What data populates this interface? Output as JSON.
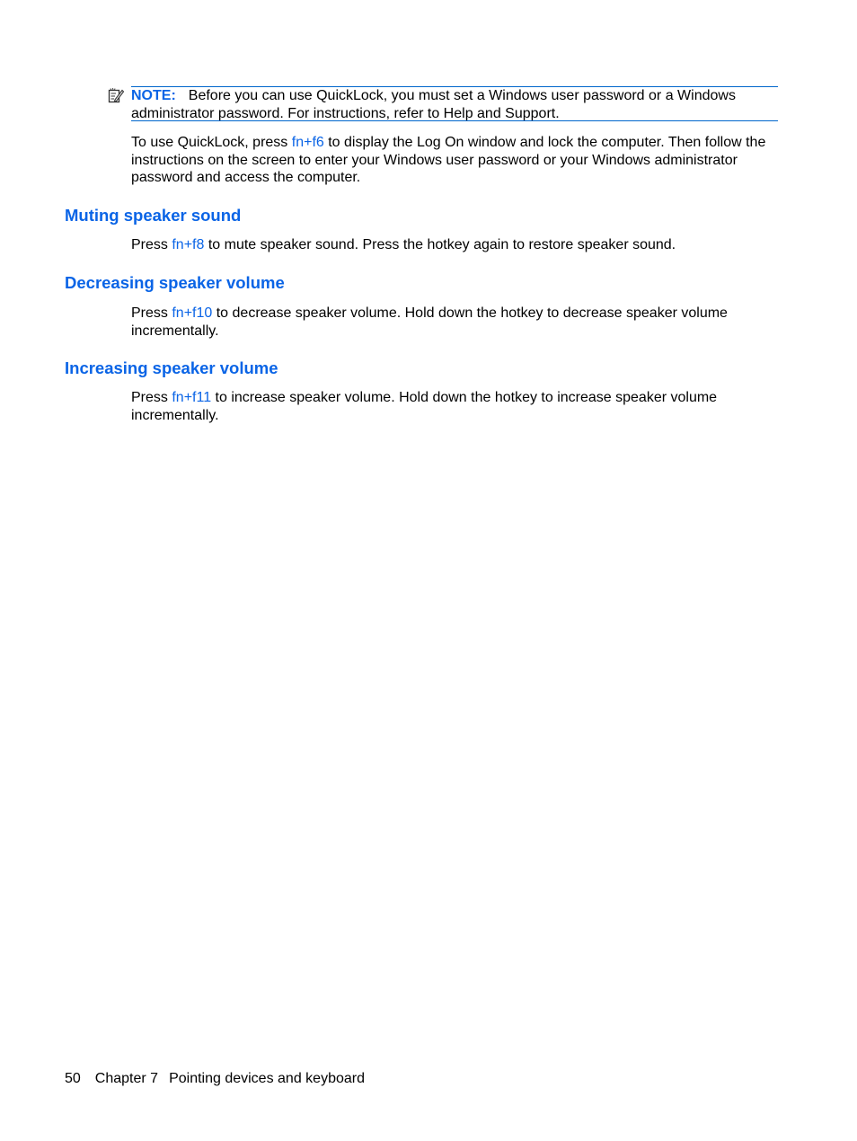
{
  "note": {
    "label": "NOTE:",
    "text": "Before you can use QuickLock, you must set a Windows user password or a Windows administrator password. For instructions, refer to Help and Support.",
    "icon": "note-icon"
  },
  "quicklock": {
    "before": "To use QuickLock, press ",
    "key": "fn+f6",
    "after": " to display the Log On window and lock the computer. Then follow the instructions on the screen to enter your Windows user password or your Windows administrator password and access the computer."
  },
  "sections": [
    {
      "heading": "Muting speaker sound",
      "before": "Press ",
      "key": "fn+f8",
      "after": " to mute speaker sound. Press the hotkey again to restore speaker sound."
    },
    {
      "heading": "Decreasing speaker volume",
      "before": "Press ",
      "key": "fn+f10",
      "after": " to decrease speaker volume. Hold down the hotkey to decrease speaker volume incrementally."
    },
    {
      "heading": "Increasing speaker volume",
      "before": "Press ",
      "key": "fn+f11",
      "after": " to increase speaker volume. Hold down the hotkey to increase speaker volume incrementally."
    }
  ],
  "footer": {
    "page_number": "50",
    "chapter": "Chapter 7",
    "chapter_title": "Pointing devices and keyboard"
  },
  "colors": {
    "accent": "#0a64e6",
    "rule": "#0066cc"
  }
}
